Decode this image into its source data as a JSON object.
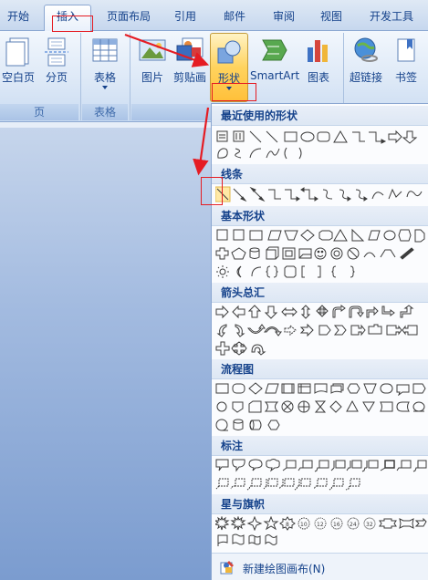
{
  "tabs": [
    "开始",
    "插入",
    "页面布局",
    "引用",
    "邮件",
    "审阅",
    "视图",
    "开发工具"
  ],
  "active_tab": "插入",
  "ribbon": {
    "buttons": {
      "blank_page": "空白页",
      "page_break": "分页",
      "table": "表格",
      "picture": "图片",
      "clip_art": "剪贴画",
      "shapes": "形状",
      "smartart": "SmartArt",
      "chart": "图表",
      "hyperlink": "超链接",
      "bookmark": "书签"
    },
    "groups": {
      "pages": "页",
      "tables": "表格"
    }
  },
  "gallery": {
    "sections": {
      "recent": "最近使用的形状",
      "lines": "线条",
      "basic": "基本形状",
      "arrows": "箭头总汇",
      "flowchart": "流程图",
      "callouts": "标注",
      "stars": "星与旗帜"
    },
    "footer": "新建绘图画布(N)"
  },
  "annotation_color": "#e51c23",
  "accent_color": "#ffc03a"
}
